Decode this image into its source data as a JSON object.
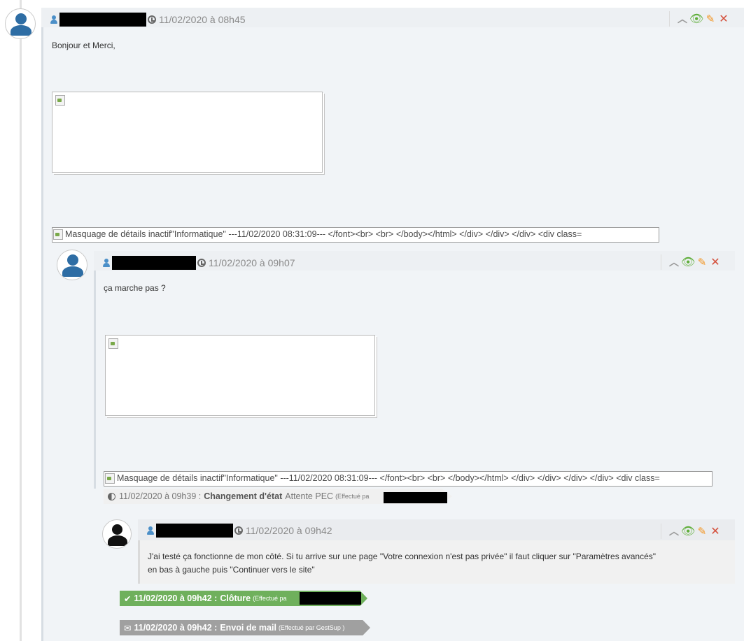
{
  "comments": [
    {
      "time": "11/02/2020 à 08h45",
      "text": "Bonjour et Merci,",
      "alt_text": "Masquage de détails inactif\"Informatique\" ---11/02/2020 08:31:09--- </font><br> <br> </body></html> </div> </div> </div> <div class="
    },
    {
      "time": "11/02/2020 à 09h07",
      "text": "ça marche pas ?",
      "alt_text": "Masquage de détails inactif\"Informatique\" ---11/02/2020 08:31:09--- </font><br> <br> </body></html> </div> </div> </div> </div> <div class="
    },
    {
      "time": "11/02/2020 à 09h42",
      "text_line1": "J'ai testé ça fonctionne de mon côté. Si tu arrive sur une page \"Votre connexion n'est pas privée\" il faut cliquer sur \"Paramètres avancés\"",
      "text_line2": "en bas à gauche puis \"Continuer vers le site\""
    }
  ],
  "events": [
    {
      "time": "11/02/2020 à 09h39 :",
      "label": "Changement d'état",
      "detail": "Attente PEC",
      "by": "(Effectué pa"
    },
    {
      "time": "11/02/2020 à 09h42 :",
      "label": "Clôture",
      "by": "(Effectué pa"
    },
    {
      "time": "11/02/2020 à 09h42 :",
      "label": "Envoi de mail",
      "by": "(Effectué par GestSup )"
    }
  ],
  "icons": {
    "user": "user-icon",
    "clock": "clock-icon",
    "collapse": "chevron-up-icon",
    "view": "eye-icon",
    "edit": "pencil-icon",
    "delete": "close-icon",
    "state": "half-circle-icon",
    "close_ticket": "check-icon",
    "mail": "envelope-icon"
  },
  "colors": {
    "avatar_blue": "#2e6da4",
    "green_event": "#6fb05c",
    "grey_event": "#a0a0a0",
    "eye": "#5fae3a",
    "pencil": "#f39521",
    "delete": "#d4503c"
  }
}
